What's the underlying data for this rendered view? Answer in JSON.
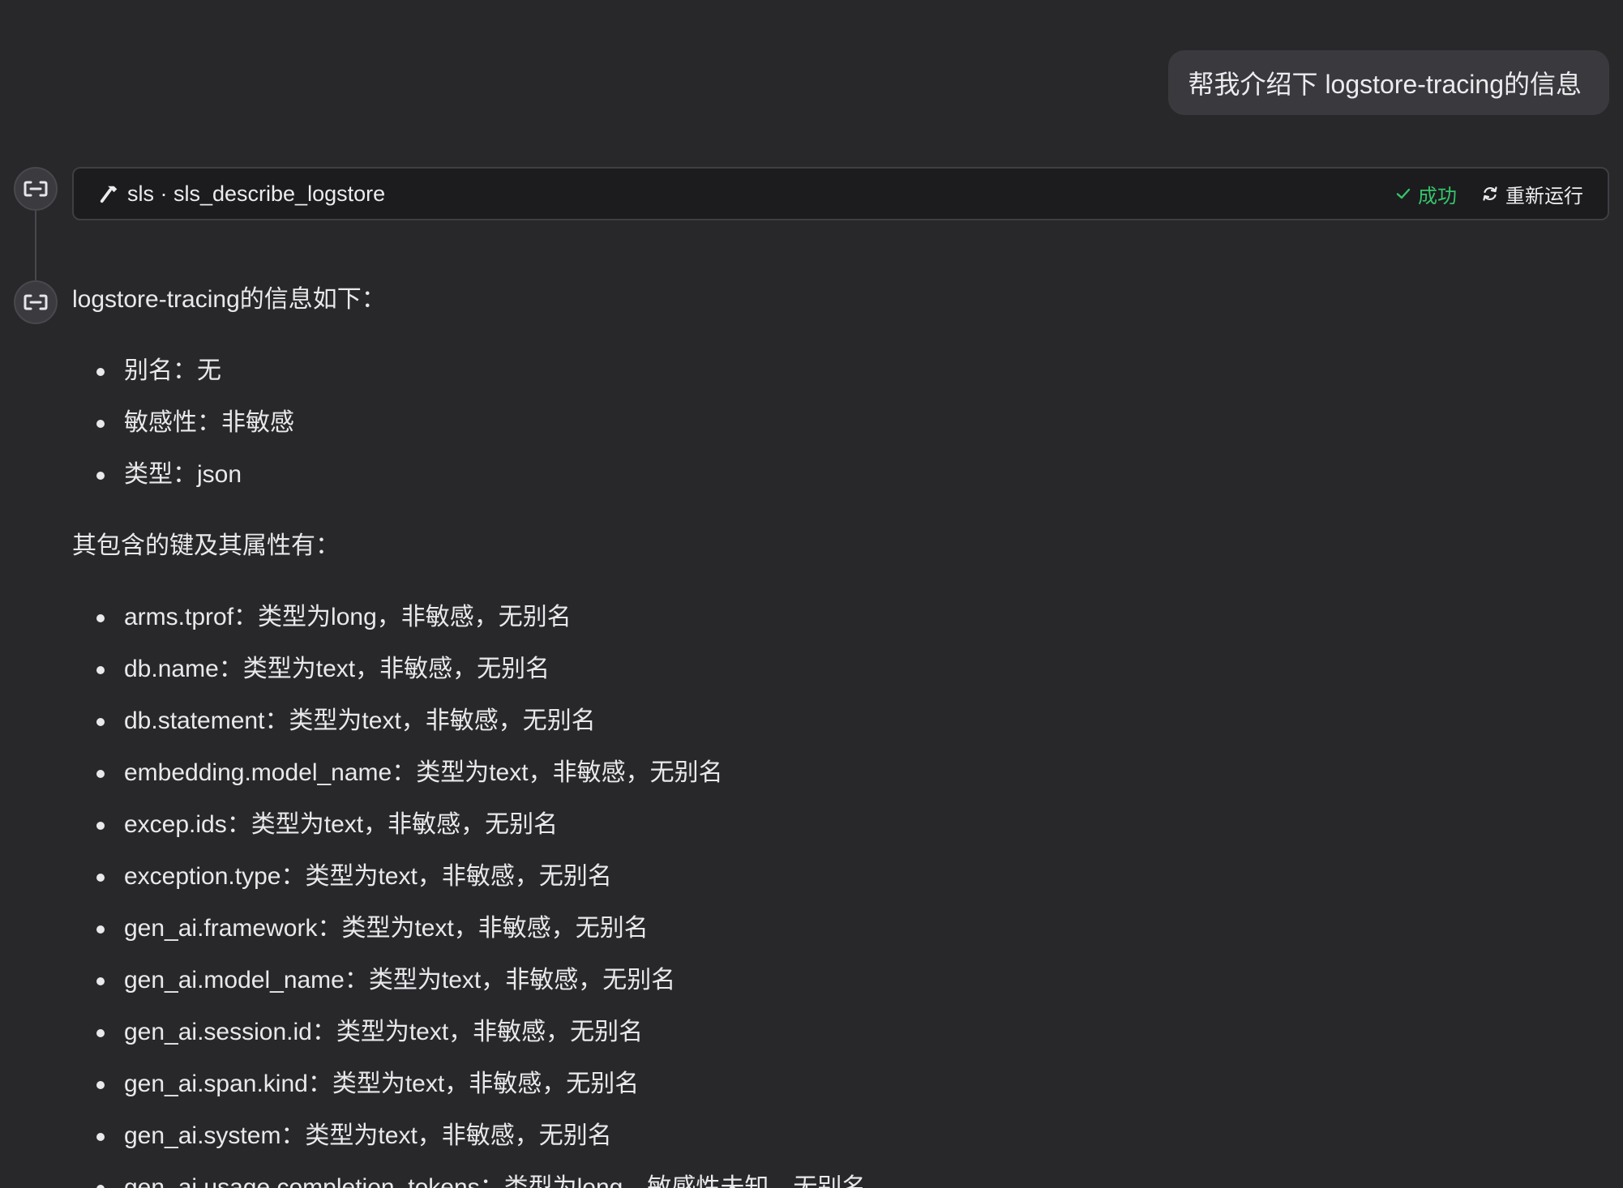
{
  "user_message": "帮我介绍下 logstore-tracing的信息",
  "tool_call": {
    "name": "sls · sls_describe_logstore",
    "icon": "hammer-icon",
    "status": "成功",
    "status_color": "#35c46a",
    "rerun_label": "重新运行"
  },
  "response": {
    "intro": "logstore-tracing的信息如下：",
    "basic_info": [
      "别名：无",
      "敏感性：非敏感",
      "类型：json"
    ],
    "keys_heading": "其包含的键及其属性有：",
    "keys": [
      "arms.tprof：类型为long，非敏感，无别名",
      "db.name：类型为text，非敏感，无别名",
      "db.statement：类型为text，非敏感，无别名",
      "embedding.model_name：类型为text，非敏感，无别名",
      "excep.ids：类型为text，非敏感，无别名",
      "exception.type：类型为text，非敏感，无别名",
      "gen_ai.framework：类型为text，非敏感，无别名",
      "gen_ai.model_name：类型为text，非敏感，无别名",
      "gen_ai.session.id：类型为text，非敏感，无别名",
      "gen_ai.span.kind：类型为text，非敏感，无别名",
      "gen_ai.system：类型为text，非敏感，无别名",
      "gen_ai.usage.completion_tokens：类型为long，敏感性未知，无别名"
    ]
  },
  "theme": {
    "background": "#28282b",
    "tool_bar_background": "#1c1c1f",
    "user_bubble_background": "#3a3a3e"
  }
}
